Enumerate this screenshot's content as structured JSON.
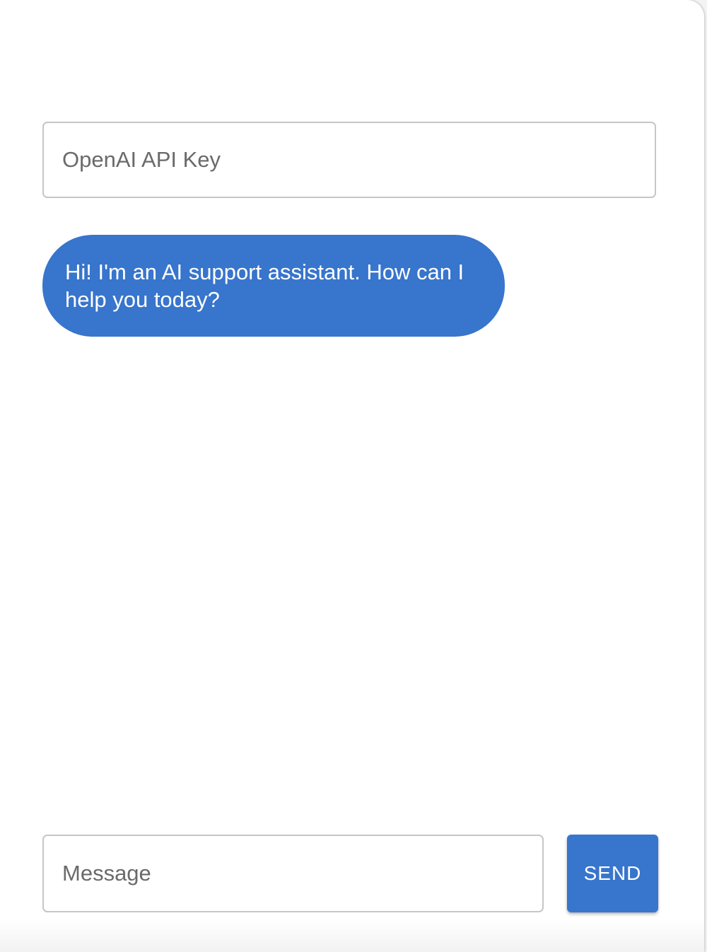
{
  "api_key": {
    "placeholder": "OpenAI API Key",
    "value": ""
  },
  "messages": [
    {
      "role": "assistant",
      "text": "Hi! I'm an AI support assistant. How can I help you today?"
    }
  ],
  "composer": {
    "placeholder": "Message",
    "value": "",
    "send_label": "SEND"
  },
  "colors": {
    "accent": "#3875CC",
    "bubble_text": "#FFFFFF",
    "border": "#C6C6C6",
    "placeholder": "#6A6A6A"
  }
}
